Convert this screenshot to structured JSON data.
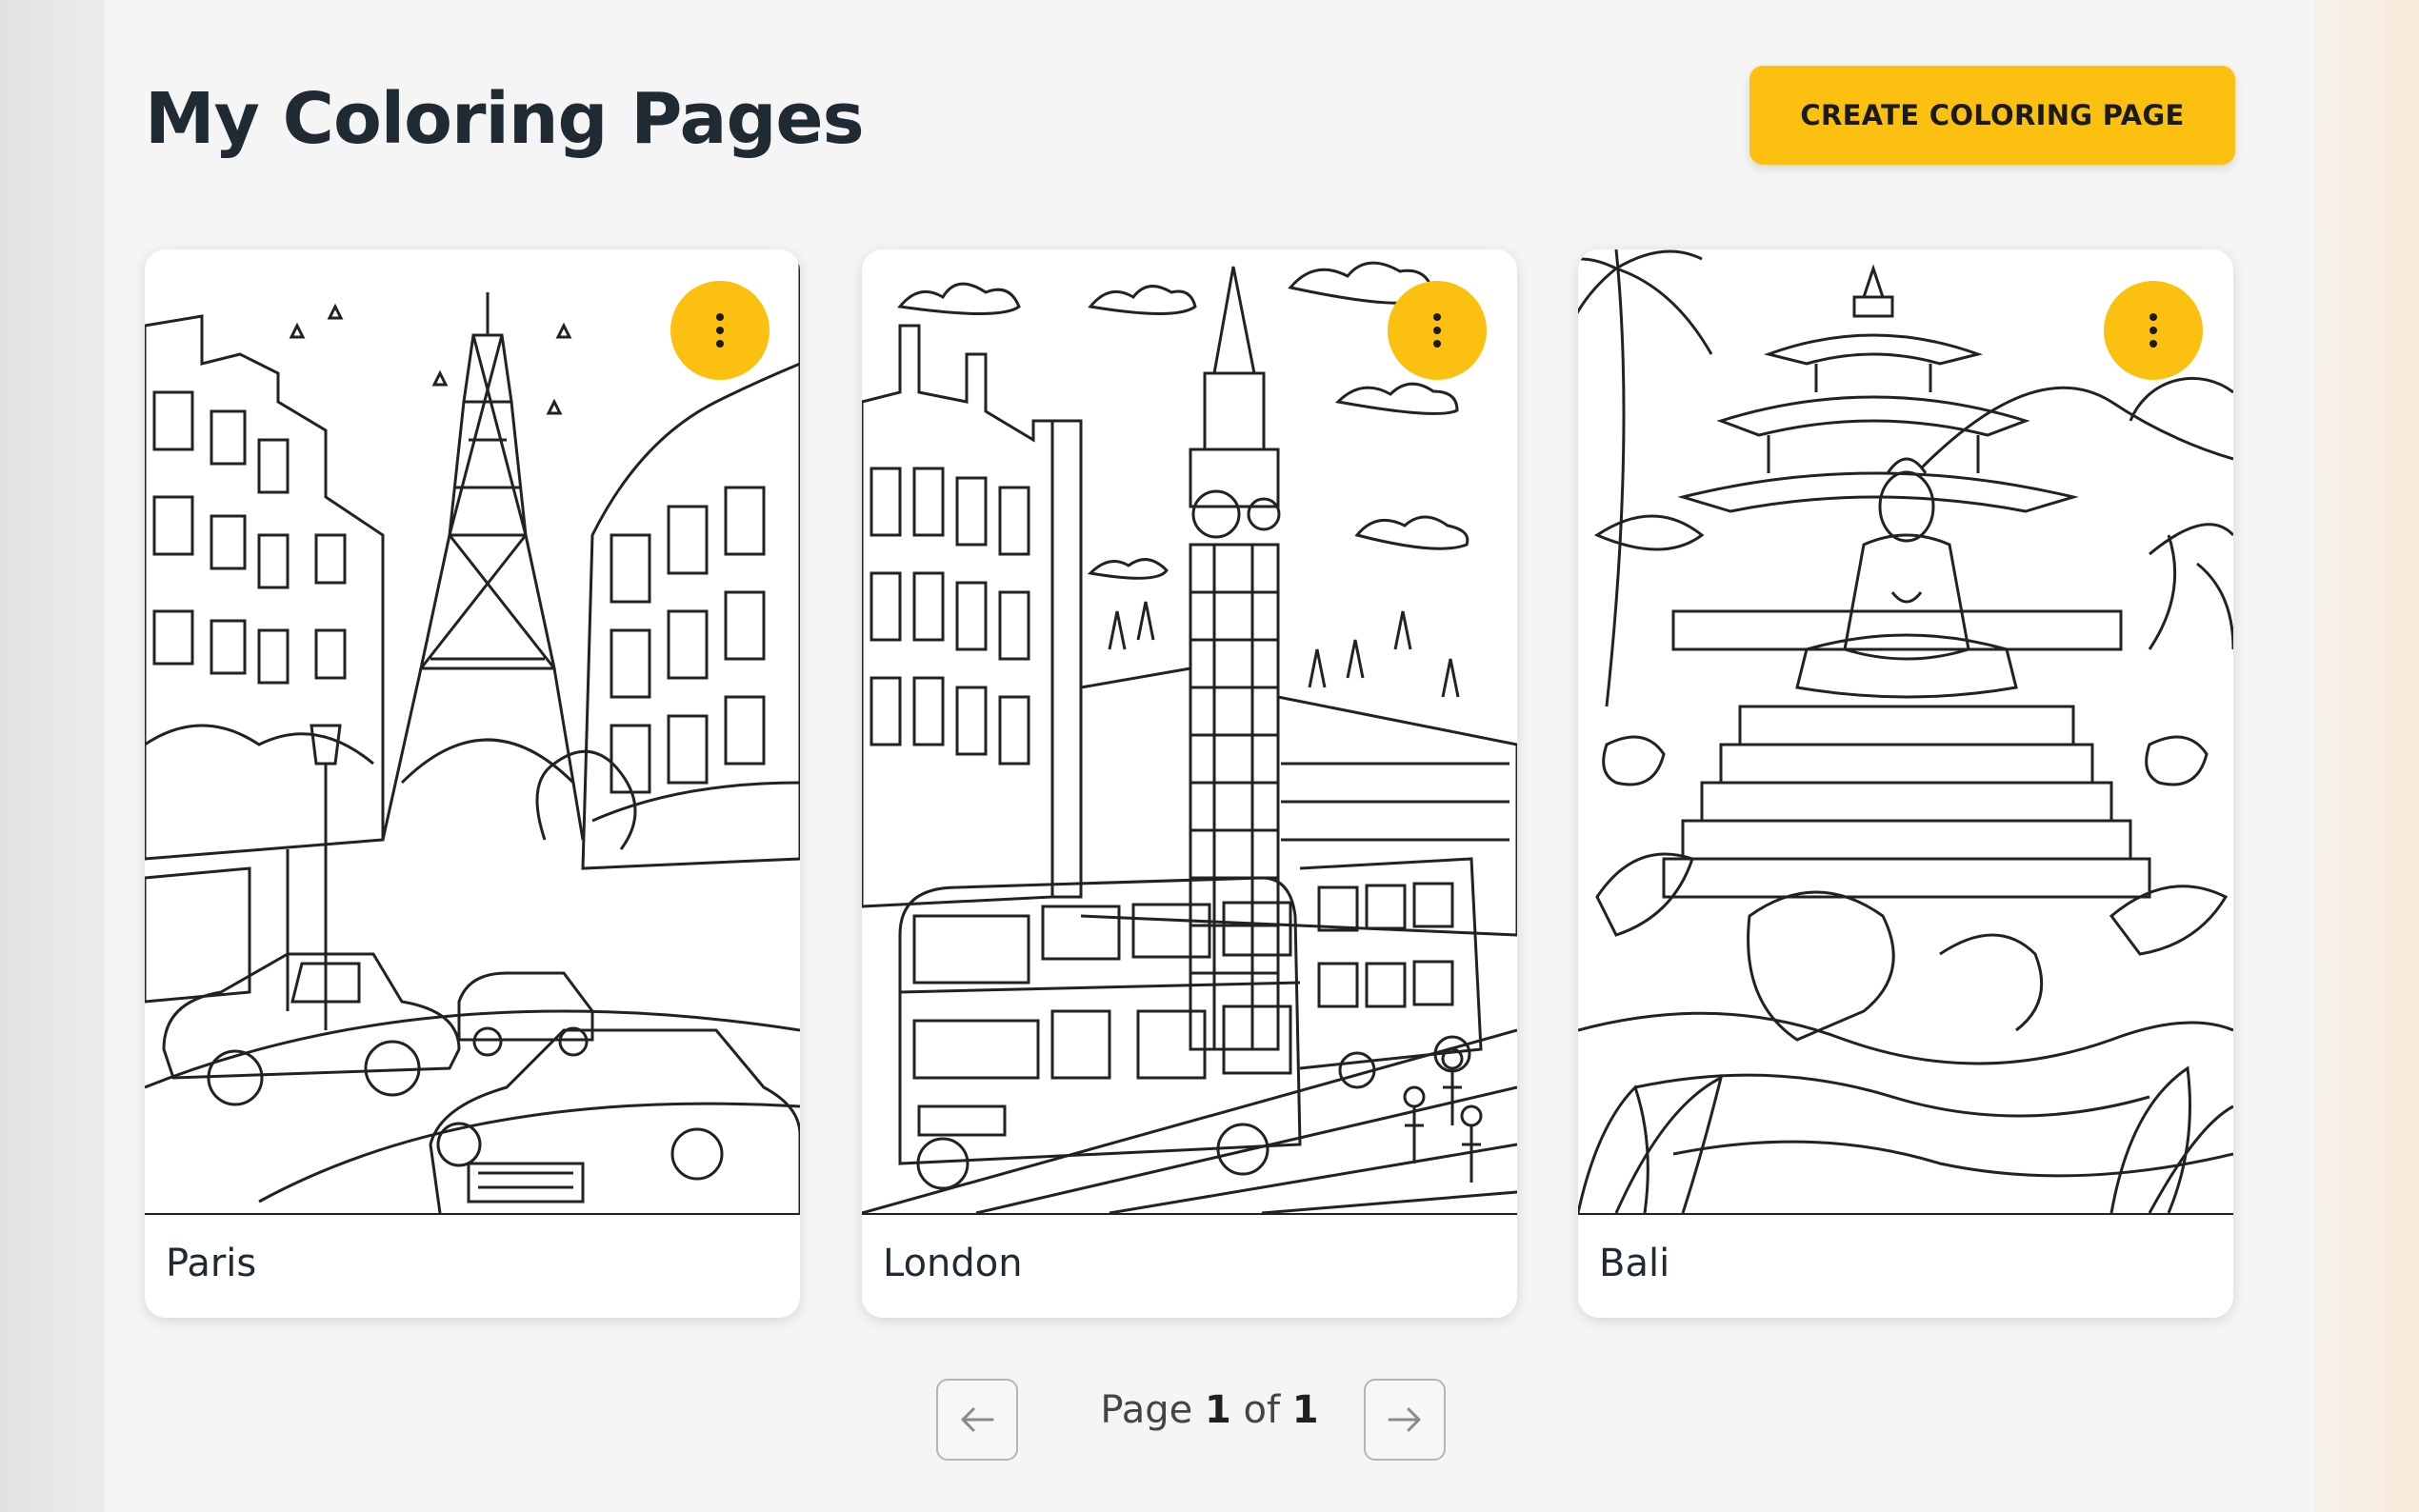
{
  "page": {
    "title": "My Coloring Pages",
    "create_button_label": "CREATE COLORING PAGE"
  },
  "cards": [
    {
      "label": "Paris",
      "menu_icon": "more-vertical-icon"
    },
    {
      "label": "London",
      "menu_icon": "more-vertical-icon"
    },
    {
      "label": "Bali",
      "menu_icon": "more-vertical-icon"
    }
  ],
  "pagination": {
    "prefix": "Page",
    "current": "1",
    "separator": "of",
    "total": "1",
    "prev_icon": "arrow-left-icon",
    "next_icon": "arrow-right-icon"
  },
  "colors": {
    "accent": "#fcc010",
    "title": "#1f2a33",
    "background": "#f5f5f5"
  }
}
